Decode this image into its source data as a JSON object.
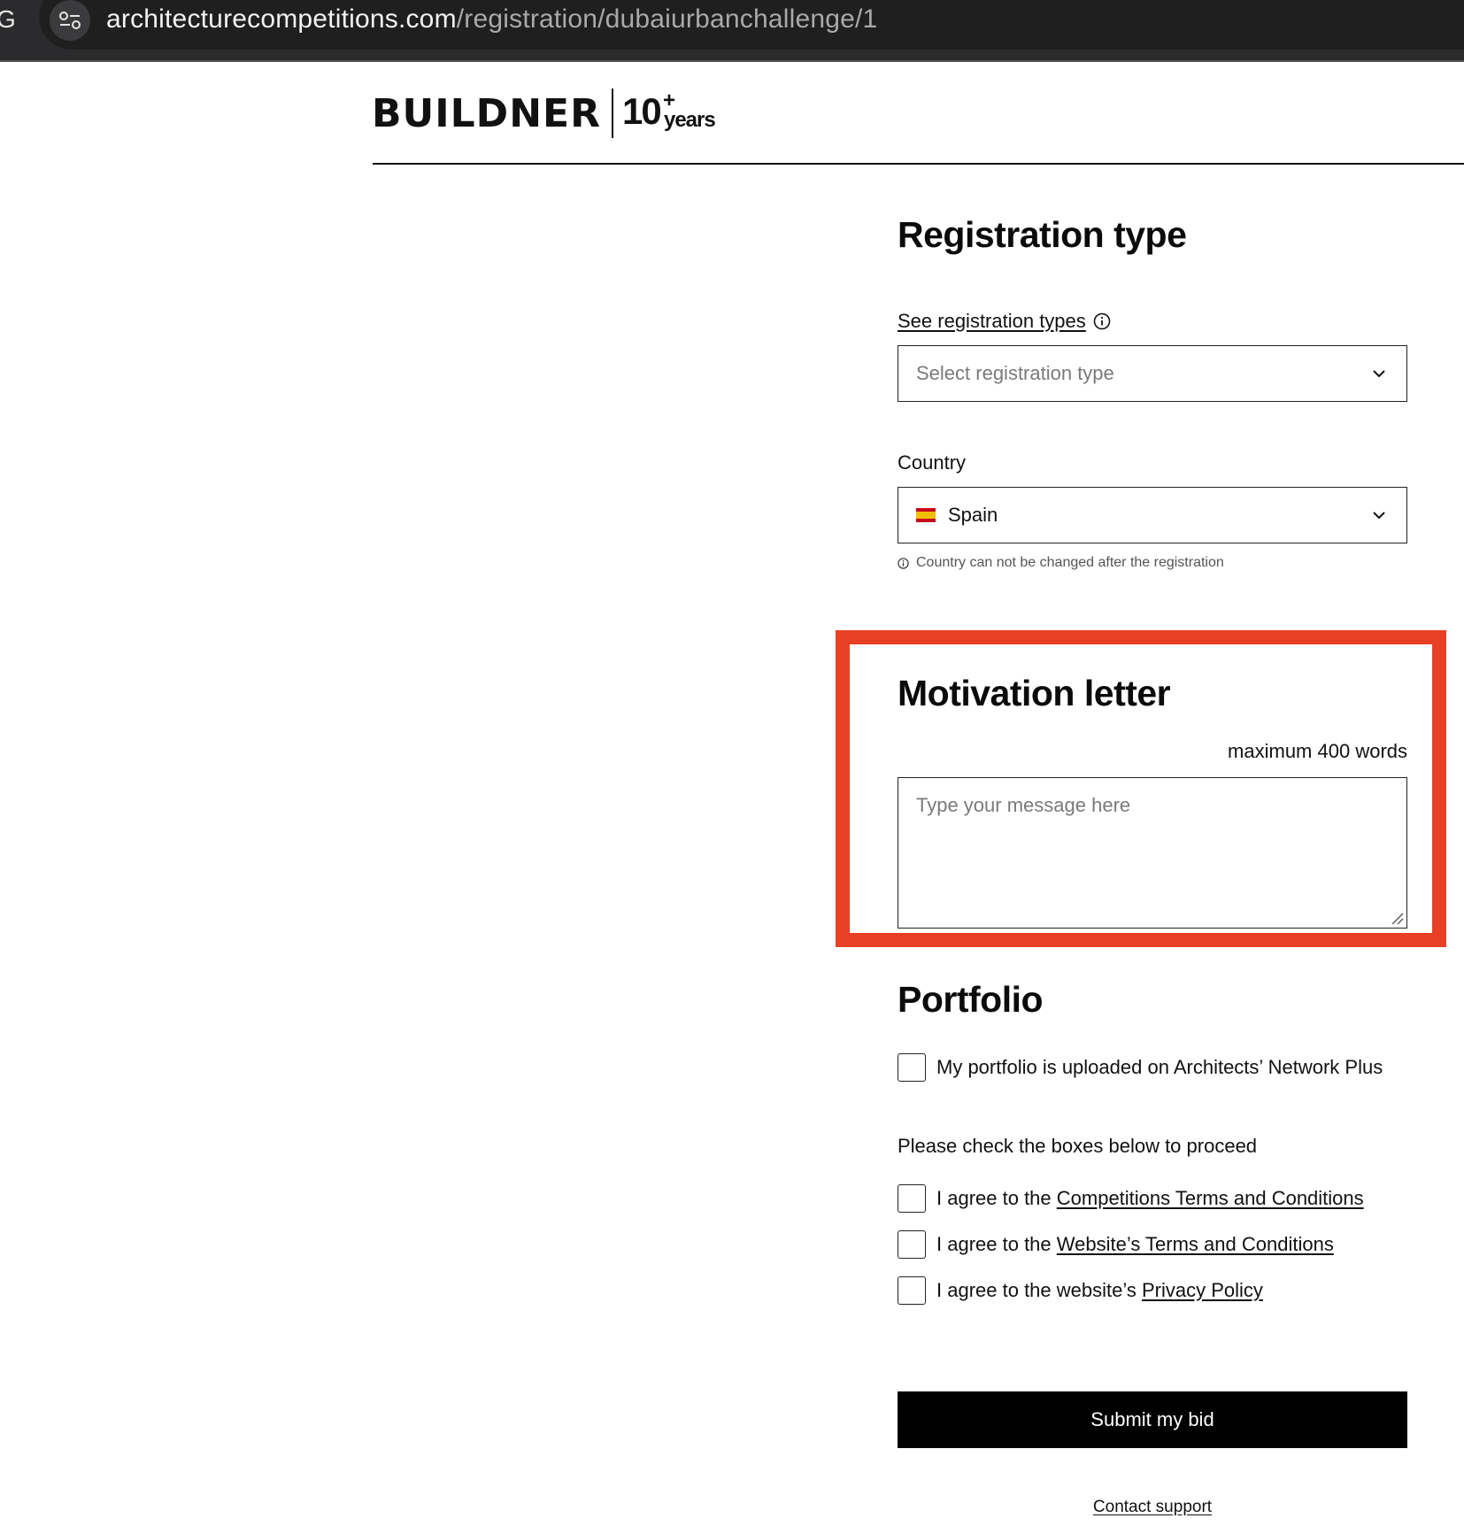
{
  "browser": {
    "url_host": "architecturecompetitions.com",
    "url_path": "/registration/dubaiurbanchallenge/1",
    "edge_glyph": "G"
  },
  "header": {
    "logo_word": "BUILDNER",
    "badge_number": "10",
    "badge_plus": "+",
    "badge_years": "years"
  },
  "registration": {
    "title": "Registration type",
    "see_types_link": "See registration types",
    "type_select_placeholder": "Select registration type",
    "country_label": "Country",
    "country_value": "Spain",
    "country_hint": "Country can not be changed after the registration"
  },
  "motivation": {
    "title": "Motivation letter",
    "max_words": "maximum 400 words",
    "message_placeholder": "Type your message here",
    "highlight_color": "#e84025"
  },
  "portfolio": {
    "title": "Portfolio",
    "uploaded_label": "My portfolio is uploaded on Architects’ Network Plus"
  },
  "agreements": {
    "intro": "Please check the boxes below to proceed",
    "items": [
      {
        "prefix": "I agree to the ",
        "link": "Competitions Terms and Conditions"
      },
      {
        "prefix": "I agree to the ",
        "link": "Website’s Terms and Conditions"
      },
      {
        "prefix": "I agree to the website’s ",
        "link": "Privacy Policy"
      }
    ]
  },
  "actions": {
    "submit_label": "Submit my bid",
    "contact_link": "Contact support"
  }
}
